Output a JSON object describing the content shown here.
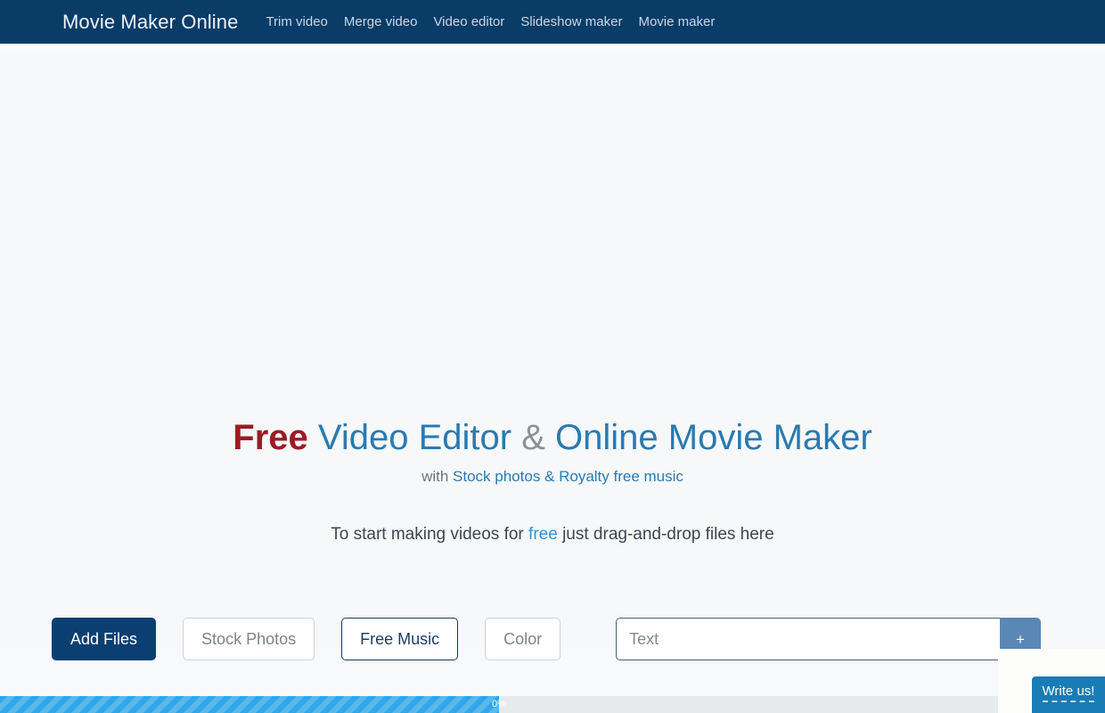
{
  "nav": {
    "brand": "Movie Maker Online",
    "links": [
      {
        "label": "Trim video"
      },
      {
        "label": "Merge video"
      },
      {
        "label": "Video editor"
      },
      {
        "label": "Slideshow maker"
      },
      {
        "label": "Movie maker"
      }
    ]
  },
  "hero": {
    "headline": {
      "free": "Free",
      "part1": " Video Editor ",
      "amp": "&",
      "part2": " Online Movie Maker"
    },
    "subhead": {
      "prefix": "with ",
      "link": "Stock photos & Royalty free music"
    },
    "dropline": {
      "before": "To start making videos for ",
      "free": "free",
      "after": " just drag-and-drop files here"
    }
  },
  "actions": {
    "add_files": "Add Files",
    "stock_photos": "Stock Photos",
    "free_music": "Free Music",
    "color": "Color",
    "text_placeholder": "Text",
    "text_value": "",
    "add_text_icon": "+"
  },
  "progress": {
    "label": "0%",
    "value": 0
  },
  "chat": {
    "label": "Write us!"
  },
  "colors": {
    "nav_bg": "#0a3c68",
    "primary": "#0b3f72",
    "link_blue": "#2a7ab0",
    "free_red": "#9b1c24",
    "progress_blue": "#31a6e8",
    "chat_blue": "#1a7cb5",
    "add_btn_blue": "#5b87b5",
    "page_bg": "#f6f8fa"
  }
}
